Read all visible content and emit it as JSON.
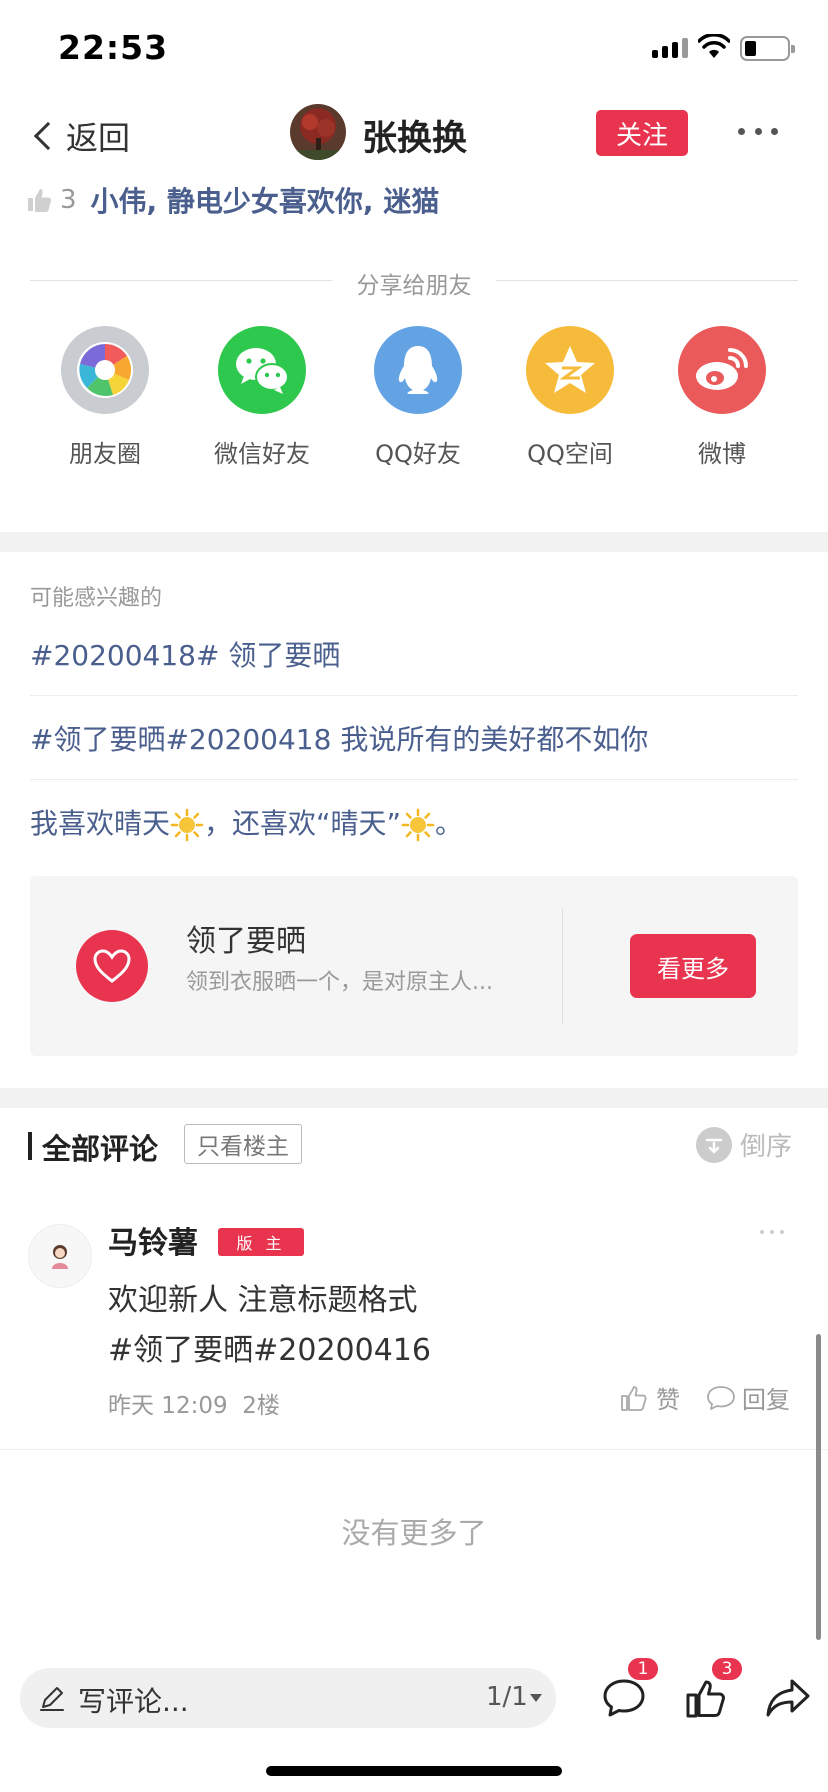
{
  "status_bar": {
    "time": "22:53"
  },
  "nav": {
    "back_label": "返回",
    "user_name": "张换换",
    "follow_label": "关注"
  },
  "likes": {
    "count": "3",
    "names": "小伟, 静电少女喜欢你, 迷猫"
  },
  "share": {
    "title": "分享给朋友",
    "items": [
      {
        "label": "朋友圈",
        "icon": "moments-icon",
        "color": "#c7ccd2"
      },
      {
        "label": "微信好友",
        "icon": "wechat-icon",
        "color": "#2dc84d"
      },
      {
        "label": "QQ好友",
        "icon": "qq-icon",
        "color": "#63a3e4"
      },
      {
        "label": "QQ空间",
        "icon": "qzone-icon",
        "color": "#f6bb3a"
      },
      {
        "label": "微博",
        "icon": "weibo-icon",
        "color": "#ea5a5a"
      }
    ]
  },
  "interest": {
    "title": "可能感兴趣的",
    "topics": [
      "#20200418# 领了要晒",
      "#领了要晒#20200418 我说所有的美好都不如你"
    ],
    "topic3": {
      "part1": "我喜欢晴天",
      "part2": "，还喜欢“晴天”",
      "part3": "。"
    },
    "card": {
      "title": "领了要晒",
      "desc": "领到衣服晒一个，是对原主人...",
      "button": "看更多"
    }
  },
  "comments": {
    "title": "全部评论",
    "only_op": "只看楼主",
    "sort_label": "倒序",
    "items": [
      {
        "name": "马铃薯",
        "badge": "版 主",
        "line1": "欢迎新人 注意标题格式",
        "line2": "#领了要晒#20200416",
        "time": "昨天 12:09",
        "floor": "2楼",
        "like_label": "赞",
        "reply_label": "回复"
      }
    ],
    "no_more": "没有更多了"
  },
  "bottom_bar": {
    "placeholder": "写评论...",
    "page": "1/1",
    "comment_badge": "1",
    "like_badge": "3"
  },
  "colors": {
    "accent": "#e8344e",
    "link": "#4a5f8e"
  }
}
